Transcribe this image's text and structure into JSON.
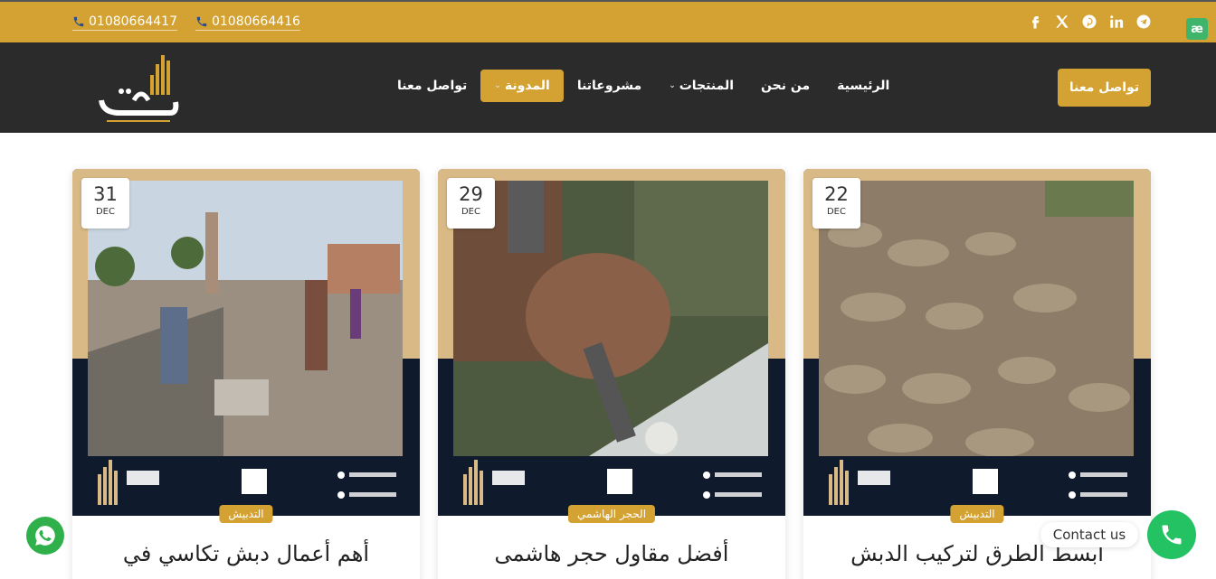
{
  "topbar": {
    "phones": [
      "01080664417",
      "01080664416"
    ],
    "socials": [
      "facebook-icon",
      "x-icon",
      "pinterest-icon",
      "linkedin-icon",
      "telegram-icon"
    ],
    "badge": "æ"
  },
  "logo": {
    "text": "طيبة"
  },
  "nav": {
    "items": [
      {
        "label": "الرئيسية",
        "dropdown": false,
        "active": false
      },
      {
        "label": "من نحن",
        "dropdown": false,
        "active": false
      },
      {
        "label": "المنتجات",
        "dropdown": true,
        "active": false
      },
      {
        "label": "مشروعاتنا",
        "dropdown": false,
        "active": false
      },
      {
        "label": "المدونة",
        "dropdown": true,
        "active": true
      },
      {
        "label": "تواصل معنا",
        "dropdown": false,
        "active": false
      }
    ],
    "cta_label": "تواصل معنا"
  },
  "cards": [
    {
      "day": "31",
      "month": "DEC",
      "category": "التدبيش",
      "title": "أهم أعمال دبش تكاسي في"
    },
    {
      "day": "29",
      "month": "DEC",
      "category": "الحجر الهاشمي",
      "title": "أفضل مقاول حجر هاشمى"
    },
    {
      "day": "22",
      "month": "DEC",
      "category": "التدبيش",
      "title": "ابسط الطرق لتركيب الدبش"
    }
  ],
  "floating": {
    "contact_label": "Contact us"
  },
  "colors": {
    "accent": "#d4a233",
    "dark": "#2b2b2b",
    "whatsapp": "#2fb04a",
    "call": "#25c264"
  }
}
